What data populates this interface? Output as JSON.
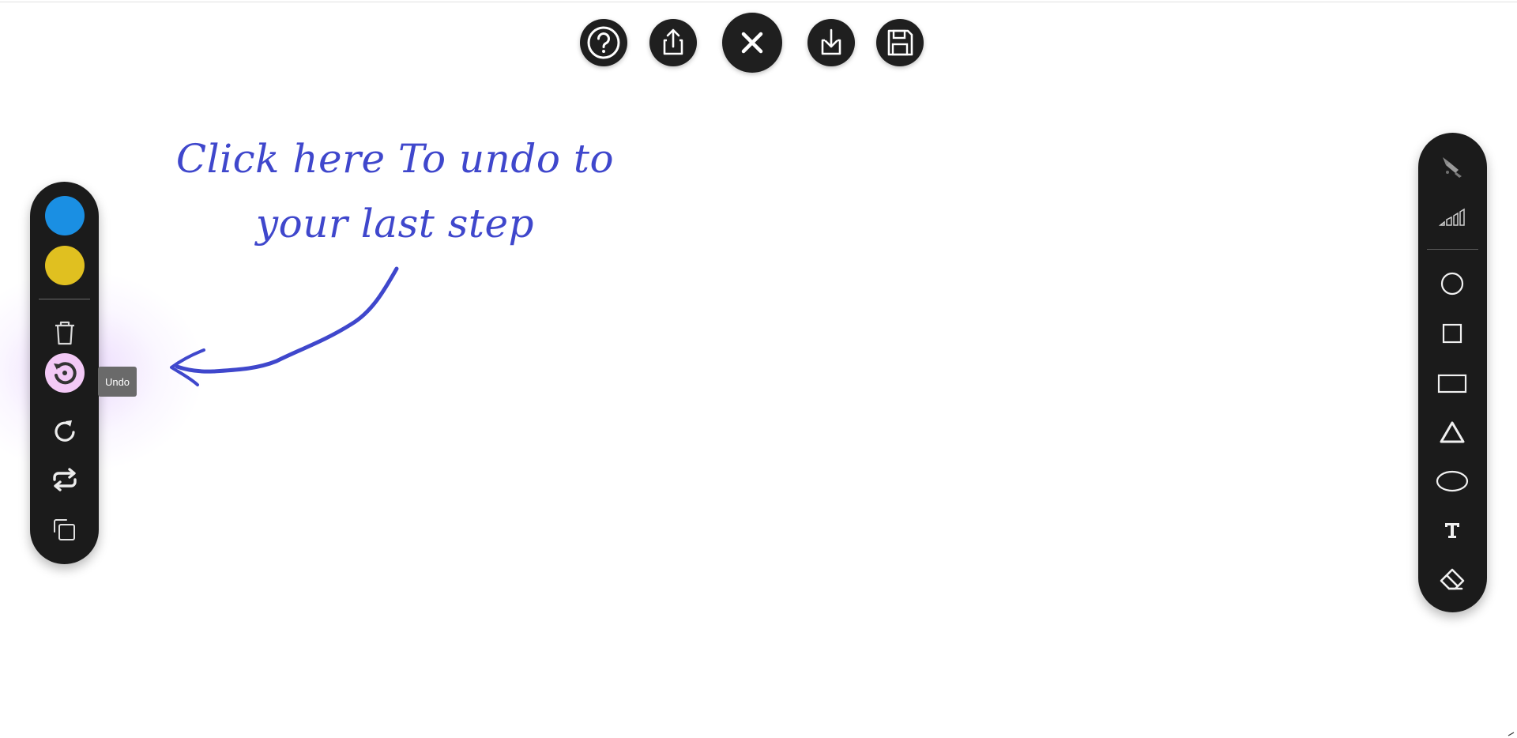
{
  "top_toolbar": {
    "buttons": [
      {
        "name": "help",
        "icon": "question-circle-icon"
      },
      {
        "name": "share",
        "icon": "upload-icon"
      },
      {
        "name": "close",
        "icon": "close-icon"
      },
      {
        "name": "download",
        "icon": "download-icon"
      },
      {
        "name": "save",
        "icon": "floppy-disk-icon"
      }
    ]
  },
  "left_palette": {
    "colors": [
      "#1a8fe3",
      "#e0c020"
    ],
    "tools": [
      "trash-icon",
      "undo-icon",
      "redo-icon",
      "repeat-icon",
      "copy-icon"
    ],
    "tooltip": "Undo",
    "active_highlight": "#f3c9f6"
  },
  "annotation": {
    "line1": "Click here To undo to",
    "line2": "your last step",
    "color": "#3f47cc"
  },
  "right_toolbar": {
    "tools": [
      "brush-icon",
      "stroke-size-icon",
      "circle-icon",
      "square-icon",
      "rectangle-icon",
      "triangle-icon",
      "ellipse-icon",
      "text-icon",
      "eraser-icon"
    ]
  }
}
